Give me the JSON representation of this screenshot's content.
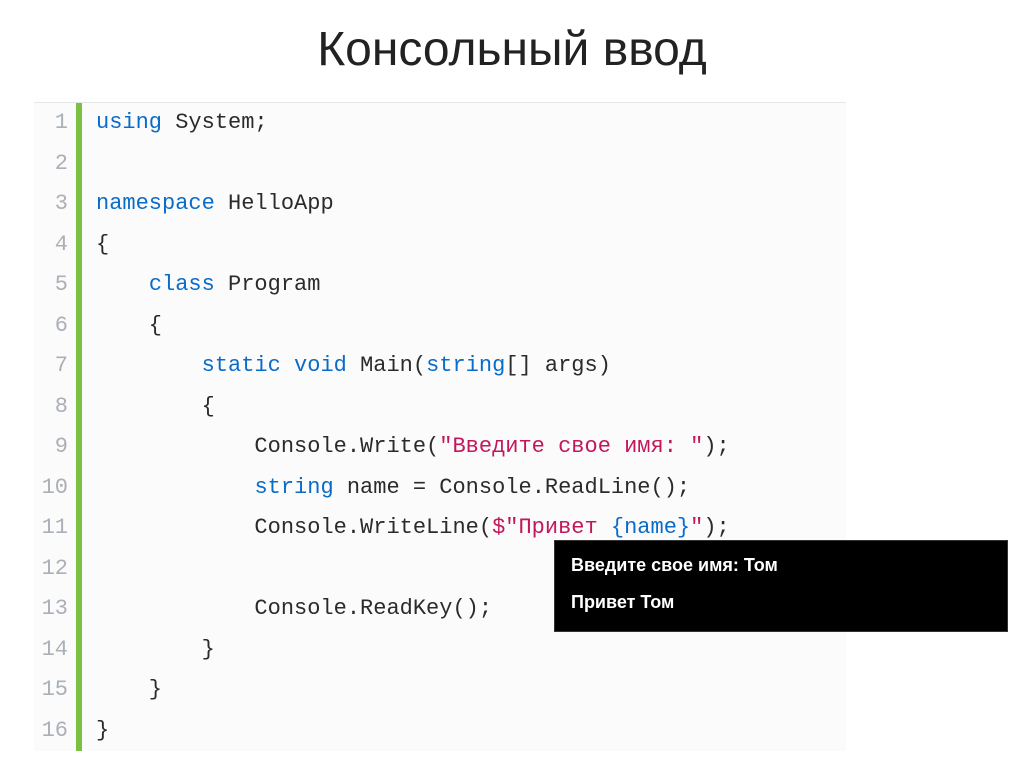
{
  "title": "Консольный ввод",
  "code": {
    "lines": [
      {
        "n": "1",
        "tokens": [
          {
            "t": "using ",
            "cls": "kw"
          },
          {
            "t": "System;",
            "cls": "type"
          }
        ]
      },
      {
        "n": "2",
        "tokens": []
      },
      {
        "n": "3",
        "tokens": [
          {
            "t": "namespace ",
            "cls": "kw"
          },
          {
            "t": "HelloApp",
            "cls": "type"
          }
        ]
      },
      {
        "n": "4",
        "tokens": [
          {
            "t": "{",
            "cls": "type"
          }
        ]
      },
      {
        "n": "5",
        "tokens": [
          {
            "t": "    ",
            "cls": ""
          },
          {
            "t": "class ",
            "cls": "kw"
          },
          {
            "t": "Program",
            "cls": "type"
          }
        ]
      },
      {
        "n": "6",
        "tokens": [
          {
            "t": "    {",
            "cls": "type"
          }
        ]
      },
      {
        "n": "7",
        "tokens": [
          {
            "t": "        ",
            "cls": ""
          },
          {
            "t": "static void ",
            "cls": "kw"
          },
          {
            "t": "Main(",
            "cls": "type"
          },
          {
            "t": "string",
            "cls": "kw"
          },
          {
            "t": "[] args)",
            "cls": "type"
          }
        ]
      },
      {
        "n": "8",
        "tokens": [
          {
            "t": "        {",
            "cls": "type"
          }
        ]
      },
      {
        "n": "9",
        "tokens": [
          {
            "t": "            Console.Write(",
            "cls": "type"
          },
          {
            "t": "\"Введите свое имя: \"",
            "cls": "str"
          },
          {
            "t": ");",
            "cls": "type"
          }
        ]
      },
      {
        "n": "10",
        "tokens": [
          {
            "t": "            ",
            "cls": ""
          },
          {
            "t": "string ",
            "cls": "kw"
          },
          {
            "t": "name = Console.ReadLine();",
            "cls": "type"
          }
        ]
      },
      {
        "n": "11",
        "tokens": [
          {
            "t": "            Console.WriteLine(",
            "cls": "type"
          },
          {
            "t": "$\"Привет ",
            "cls": "str"
          },
          {
            "t": "{name}",
            "cls": "interp"
          },
          {
            "t": "\"",
            "cls": "str"
          },
          {
            "t": ");",
            "cls": "type"
          }
        ]
      },
      {
        "n": "12",
        "tokens": []
      },
      {
        "n": "13",
        "tokens": [
          {
            "t": "            Console.ReadKey();",
            "cls": "type"
          }
        ]
      },
      {
        "n": "14",
        "tokens": [
          {
            "t": "        }",
            "cls": "type"
          }
        ]
      },
      {
        "n": "15",
        "tokens": [
          {
            "t": "    }",
            "cls": "type"
          }
        ]
      },
      {
        "n": "16",
        "tokens": [
          {
            "t": "}",
            "cls": "type"
          }
        ]
      }
    ]
  },
  "console": {
    "line1": "Введите свое имя: Том",
    "line2": "Привет Том"
  }
}
